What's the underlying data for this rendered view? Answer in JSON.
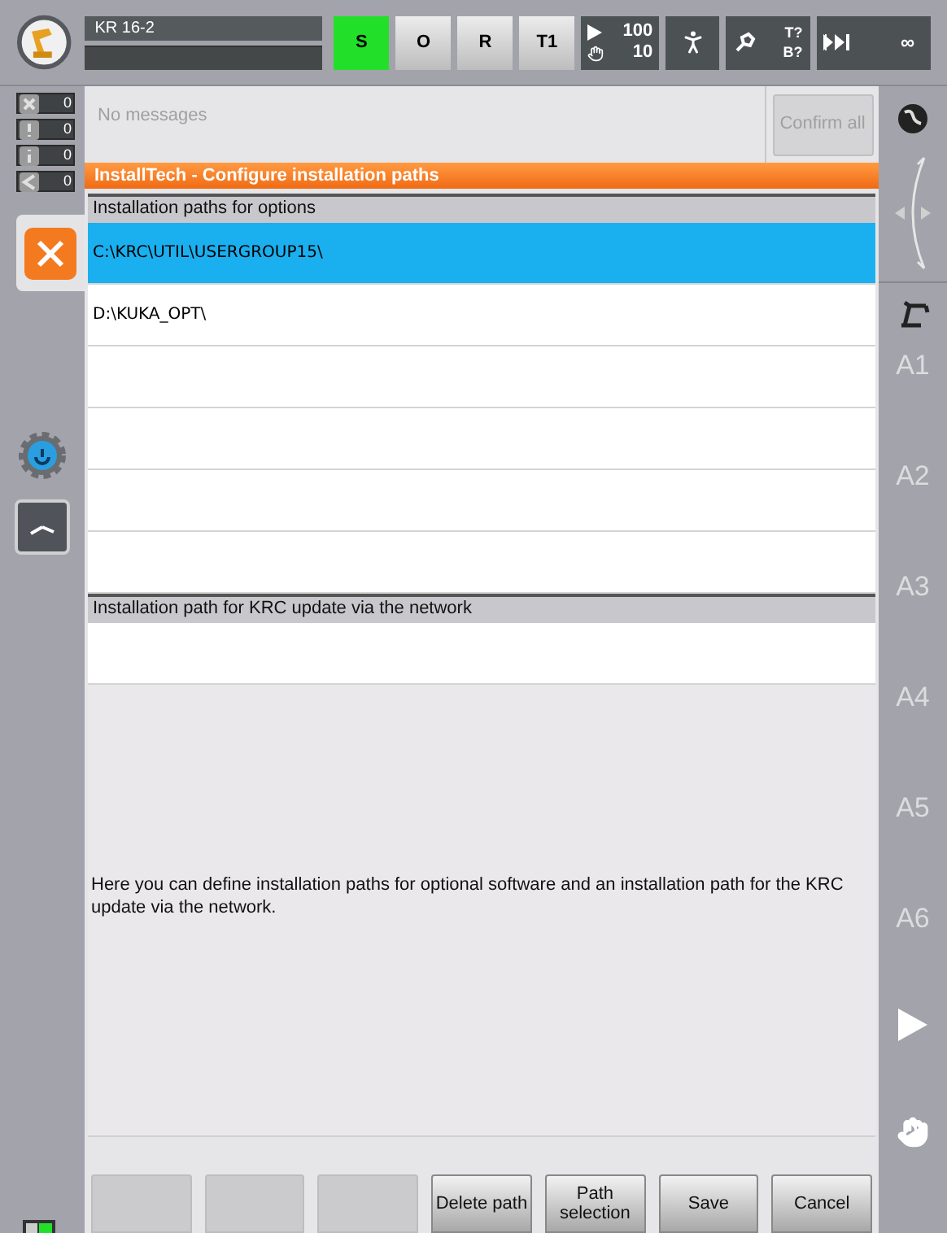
{
  "robot": {
    "name": "KR 16-2"
  },
  "modes": [
    {
      "label": "S",
      "selected": true
    },
    {
      "label": "O",
      "selected": false
    },
    {
      "label": "R",
      "selected": false
    },
    {
      "label": "T1",
      "selected": false
    }
  ],
  "override": {
    "program": "100",
    "jog": "10"
  },
  "tool_base": {
    "tool": "T?",
    "base": "B?"
  },
  "run_mode": {
    "label": "∞"
  },
  "counters": [
    {
      "kind": "error",
      "count": "0"
    },
    {
      "kind": "warning",
      "count": "0"
    },
    {
      "kind": "info",
      "count": "0"
    },
    {
      "kind": "wait",
      "count": "0"
    }
  ],
  "messages": {
    "text": "No messages",
    "confirm_button": {
      "label": "Confirm all",
      "disabled": true
    }
  },
  "window": {
    "title": "InstallTech - Configure installation paths"
  },
  "options_paths": {
    "heading": "Installation paths for options",
    "rows": [
      {
        "path": "C:\\KRC\\UTIL\\USERGROUP15\\",
        "selected": true
      },
      {
        "path": "D:\\KUKA_OPT\\",
        "selected": false
      }
    ]
  },
  "update_path": {
    "heading": "Installation path for KRC update via the network"
  },
  "description": "Here you can define installation paths for optional software and an installation path for the KRC update via the network.",
  "axes": [
    "A1",
    "A2",
    "A3",
    "A4",
    "A5",
    "A6"
  ],
  "softkeys": [
    {
      "kind": "blank"
    },
    {
      "kind": "blank"
    },
    {
      "kind": "blank"
    },
    {
      "kind": "action",
      "label": "Delete path"
    },
    {
      "kind": "action",
      "label": "Path selection"
    },
    {
      "kind": "action",
      "label": "Save"
    },
    {
      "kind": "action",
      "label": "Cancel"
    }
  ]
}
